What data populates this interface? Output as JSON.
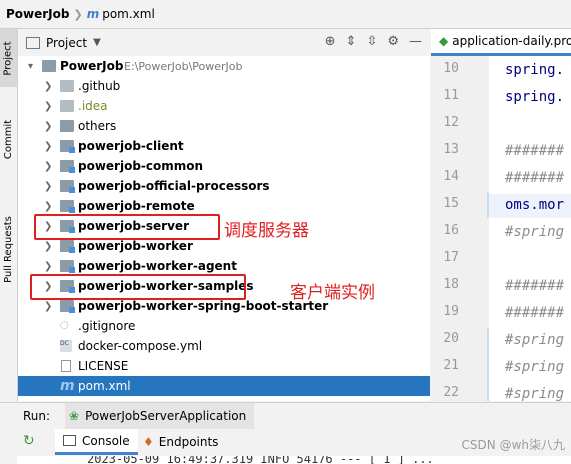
{
  "breadcrumb": {
    "project": "PowerJob",
    "file_icon": "m",
    "file": "pom.xml"
  },
  "left_strip": {
    "tabs": [
      "Project",
      "Commit",
      "Pull Requests"
    ]
  },
  "project_panel": {
    "title": "Project",
    "tools": [
      "target-icon",
      "collapse-icon",
      "expand-icon",
      "gear-icon",
      "hide-icon"
    ]
  },
  "tree": {
    "root": {
      "name": "PowerJob",
      "path": "E:\\PowerJob\\PowerJob"
    },
    "items": [
      {
        "label": ".github"
      },
      {
        "label": ".idea"
      },
      {
        "label": "others"
      },
      {
        "label": "powerjob-client"
      },
      {
        "label": "powerjob-common"
      },
      {
        "label": "powerjob-official-processors"
      },
      {
        "label": "powerjob-remote"
      },
      {
        "label": "powerjob-server"
      },
      {
        "label": "powerjob-worker"
      },
      {
        "label": "powerjob-worker-agent"
      },
      {
        "label": "powerjob-worker-samples"
      },
      {
        "label": "powerjob-worker-spring-boot-starter"
      },
      {
        "label": ".gitignore"
      },
      {
        "label": "docker-compose.yml"
      },
      {
        "label": "LICENSE"
      },
      {
        "label": "pom.xml"
      }
    ]
  },
  "annotations": {
    "server": "调度服务器",
    "samples": "客户端实例"
  },
  "editor": {
    "tab": "application-daily.pro",
    "line_numbers": [
      "10",
      "11",
      "12",
      "13",
      "14",
      "15",
      "16",
      "17",
      "18",
      "19",
      "20",
      "21",
      "22"
    ],
    "lines": [
      "spring.",
      "spring.",
      "",
      "#######",
      "#######",
      "oms.mor",
      "#spring",
      "",
      "#######",
      "#######",
      "#spring",
      "#spring",
      "#spring"
    ]
  },
  "run": {
    "label": "Run:",
    "config": "PowerJobServerApplication"
  },
  "console": {
    "tab_console": "Console",
    "tab_endpoints": "Endpoints",
    "log": "2023-05-09 16:49:37.319  INFO 54176 --- [ 1 ] ..."
  },
  "watermark": "CSDN @wh柒八九",
  "colors": {
    "selection": "#2675bf",
    "annotation": "#e02020",
    "accent": "#4083c9"
  }
}
